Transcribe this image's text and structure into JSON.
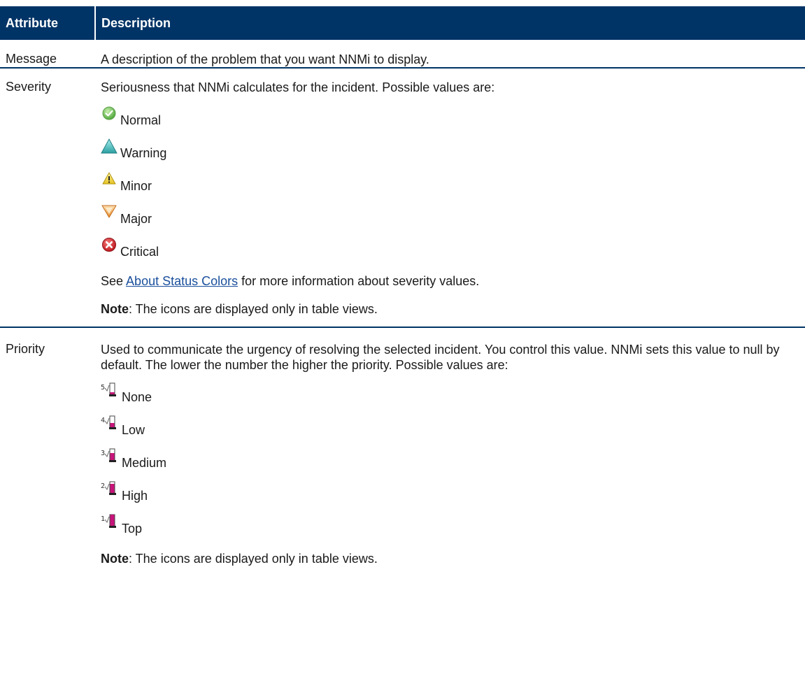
{
  "table": {
    "headers": {
      "attribute": "Attribute",
      "description": "Description"
    },
    "rows": {
      "message": {
        "name": "Message",
        "text": "A description of the problem that you want NNMi to display."
      },
      "severity": {
        "name": "Severity",
        "intro": "Seriousness that NNMi calculates for the incident. Possible values are:",
        "values": [
          {
            "label": "Normal",
            "icon": "normal-check-icon",
            "color": "#6cc24a"
          },
          {
            "label": "Warning",
            "icon": "warning-triangle-icon",
            "color": "#3fb5b5"
          },
          {
            "label": "Minor",
            "icon": "minor-alert-icon",
            "color": "#f2d22e"
          },
          {
            "label": "Major",
            "icon": "major-down-triangle-icon",
            "color": "#f0a040"
          },
          {
            "label": "Critical",
            "icon": "critical-x-icon",
            "color": "#d9262b"
          }
        ],
        "see_prefix": "See ",
        "see_link": "About Status Colors",
        "see_suffix": " for more information about severity values.",
        "note_label": "Note",
        "note_text": ": The icons are displayed only in table views."
      },
      "priority": {
        "name": "Priority",
        "intro": "Used to communicate the urgency of resolving the selected incident. You control this value. NNMi sets this value to null by default. The lower the number the higher the priority. Possible values are:",
        "values": [
          {
            "label": "None",
            "number": "5",
            "level": 0,
            "icon": "priority-5-icon"
          },
          {
            "label": "Low",
            "number": "4",
            "level": 1,
            "icon": "priority-4-icon"
          },
          {
            "label": "Medium",
            "number": "3",
            "level": 2,
            "icon": "priority-3-icon"
          },
          {
            "label": "High",
            "number": "2",
            "level": 3,
            "icon": "priority-2-icon"
          },
          {
            "label": "Top",
            "number": "1",
            "level": 4,
            "icon": "priority-1-icon"
          }
        ],
        "note_label": "Note",
        "note_text": ": The icons are displayed only in table views."
      }
    }
  },
  "colors": {
    "header_bg": "#003466",
    "header_text": "#ffffff",
    "link": "#1a4f9c",
    "priority_fill": "#c8147a"
  }
}
